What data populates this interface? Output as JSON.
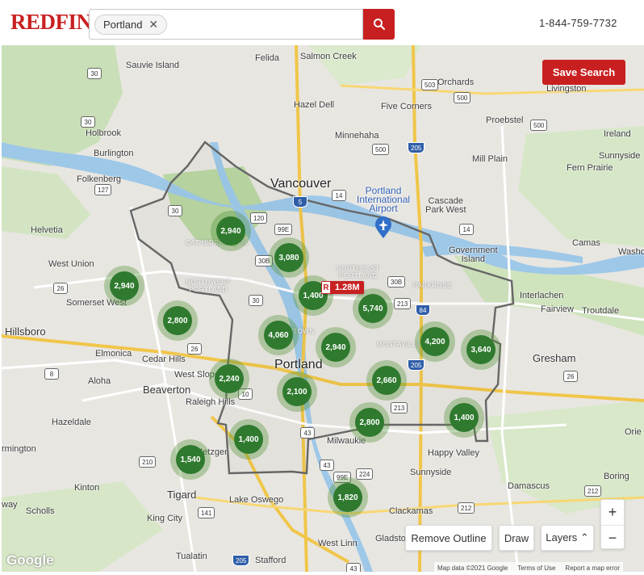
{
  "header": {
    "logo": "REDFIN",
    "search_chip": "Portland",
    "search_chip_remove": "✕",
    "phone": "1-844-759-7732"
  },
  "map": {
    "save_search": "Save Search",
    "price_marker": {
      "badge": "R",
      "price": "1.28M"
    },
    "clusters": [
      "2,940",
      "3,080",
      "2,940",
      "1,400",
      "5,740",
      "2,800",
      "4,060",
      "2,940",
      "4,200",
      "3,640",
      "2,240",
      "2,100",
      "2,660",
      "2,800",
      "1,400",
      "1,400",
      "1,540",
      "1,820"
    ],
    "places": {
      "sauvie_island": "Sauvie Island",
      "felida": "Felida",
      "salmon_creek": "Salmon Creek",
      "orchards": "Orchards",
      "livingston": "Livingston",
      "hazel_dell": "Hazel Dell",
      "five_corners": "Five Corners",
      "holbrook": "Holbrook",
      "burlington": "Burlington",
      "minnehaha": "Minnehaha",
      "proebstel": "Proebstel",
      "ireland": "Ireland",
      "mill_plain": "Mill Plain",
      "sunnyside_n": "Sunnyside",
      "fern_prairie": "Fern Prairie",
      "folkenberg": "Folkenberg",
      "vancouver": "Vancouver",
      "pdx_airport": "Portland\nInternational\nAirport",
      "cascade_park": "Cascade\nPark West",
      "helvetia": "Helvetia",
      "camas": "Camas",
      "washougal": "Washo",
      "government_island": "Government\nIsland",
      "west_union": "West Union",
      "cathedral_park": "CATHEDRAL PARK",
      "northeast_portland": "NORTHEAST\nPORTLAND",
      "north_portland": "NORTHWEST\nPORTLAND",
      "parkrose": "PARKROSE",
      "somerset_west": "Somerset West",
      "interlachen": "Interlachen",
      "fairview": "Fairview",
      "troutdale": "Troutdale",
      "hillsboro": "Hillsboro",
      "elmonica": "Elmonica",
      "cedar_hills": "Cedar Hills",
      "montavilla": "MONTAVILLA",
      "gresham": "Gresham",
      "aloha": "Aloha",
      "west_slope": "West Slope",
      "portland": "Portland",
      "beaverton": "Beaverton",
      "raleigh_hills": "Raleigh Hills",
      "hazeldale": "Hazeldale",
      "happy_valley": "Happy Valley",
      "orient": "Orie",
      "farmington": "rmington",
      "metzger": "Metzger",
      "milwaukie": "Milwaukie",
      "sunnyside_s": "Sunnyside",
      "boring": "Boring",
      "kinton": "Kinton",
      "tigard": "Tigard",
      "lake_oswego": "Lake Oswego",
      "damascus": "Damascus",
      "scholls": "Scholls",
      "king_city": "King City",
      "clackamas": "Clackamas",
      "way": "way",
      "west_linn": "West Linn",
      "gladstone": "Gladsto",
      "tualatin": "Tualatin",
      "stafford": "Stafford",
      "downtown": "DOWNTOWN"
    },
    "controls": {
      "remove_outline": "Remove Outline",
      "draw": "Draw",
      "layers": "Layers ⌃",
      "zoom_in": "+",
      "zoom_out": "−"
    },
    "google": "Google",
    "attribution": {
      "map_data": "Map data ©2021 Google",
      "terms": "Terms of Use",
      "report": "Report a map error"
    }
  }
}
